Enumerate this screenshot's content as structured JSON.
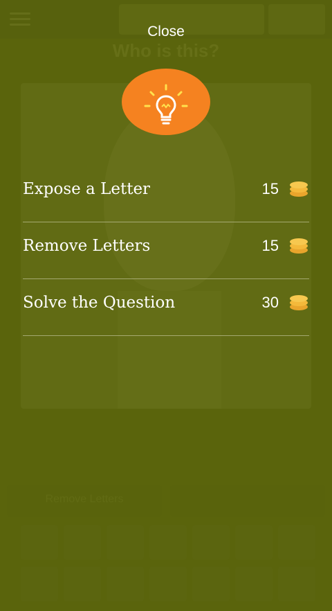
{
  "background": {
    "question": "Who is this?",
    "reveal_button_label": "Remove Letters"
  },
  "overlay": {
    "close_label": "Close",
    "hint_icon": "lightbulb-icon",
    "accent_color": "#f58220",
    "coin_color": "#f4b93b",
    "options": [
      {
        "label": "Expose a Letter",
        "cost": "15"
      },
      {
        "label": "Remove Letters",
        "cost": "15"
      },
      {
        "label": "Solve the Question",
        "cost": "30"
      }
    ]
  }
}
